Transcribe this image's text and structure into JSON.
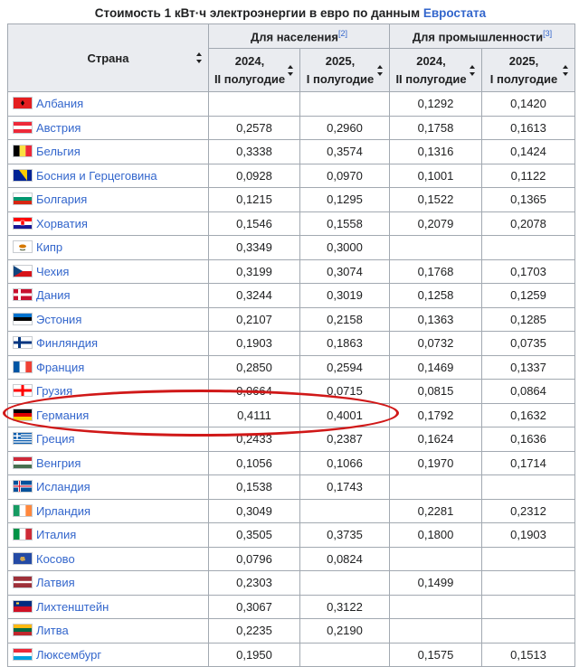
{
  "caption": {
    "text": "Стоимость 1 кВт·ч электроэнергии в евро по данным ",
    "source_link": "Евростата"
  },
  "header": {
    "country": "Страна",
    "households": "Для населения",
    "households_ref": "[2]",
    "industry": "Для промышленности",
    "industry_ref": "[3]",
    "period_2024": "2024,",
    "period_2024_half": "II полугодие",
    "period_2025": "2025,",
    "period_2025_half": "I полугодие"
  },
  "rows": [
    {
      "country": "Албания",
      "flag": "AL",
      "h2024": "",
      "h2025": "",
      "i2024": "0,1292",
      "i2025": "0,1420"
    },
    {
      "country": "Австрия",
      "flag": "AT",
      "h2024": "0,2578",
      "h2025": "0,2960",
      "i2024": "0,1758",
      "i2025": "0,1613"
    },
    {
      "country": "Бельгия",
      "flag": "BE",
      "h2024": "0,3338",
      "h2025": "0,3574",
      "i2024": "0,1316",
      "i2025": "0,1424"
    },
    {
      "country": "Босния и Герцеговина",
      "flag": "BA",
      "h2024": "0,0928",
      "h2025": "0,0970",
      "i2024": "0,1001",
      "i2025": "0,1122"
    },
    {
      "country": "Болгария",
      "flag": "BG",
      "h2024": "0,1215",
      "h2025": "0,1295",
      "i2024": "0,1522",
      "i2025": "0,1365"
    },
    {
      "country": "Хорватия",
      "flag": "HR",
      "h2024": "0,1546",
      "h2025": "0,1558",
      "i2024": "0,2079",
      "i2025": "0,2078"
    },
    {
      "country": "Кипр",
      "flag": "CY",
      "h2024": "0,3349",
      "h2025": "0,3000",
      "i2024": "",
      "i2025": ""
    },
    {
      "country": "Чехия",
      "flag": "CZ",
      "h2024": "0,3199",
      "h2025": "0,3074",
      "i2024": "0,1768",
      "i2025": "0,1703"
    },
    {
      "country": "Дания",
      "flag": "DK",
      "h2024": "0,3244",
      "h2025": "0,3019",
      "i2024": "0,1258",
      "i2025": "0,1259"
    },
    {
      "country": "Эстония",
      "flag": "EE",
      "h2024": "0,2107",
      "h2025": "0,2158",
      "i2024": "0,1363",
      "i2025": "0,1285"
    },
    {
      "country": "Финляндия",
      "flag": "FI",
      "h2024": "0,1903",
      "h2025": "0,1863",
      "i2024": "0,0732",
      "i2025": "0,0735"
    },
    {
      "country": "Франция",
      "flag": "FR",
      "h2024": "0,2850",
      "h2025": "0,2594",
      "i2024": "0,1469",
      "i2025": "0,1337"
    },
    {
      "country": "Грузия",
      "flag": "GE",
      "h2024": "0,0664",
      "h2025": "0,0715",
      "i2024": "0,0815",
      "i2025": "0,0864"
    },
    {
      "country": "Германия",
      "flag": "DE",
      "h2024": "0,4111",
      "h2025": "0,4001",
      "i2024": "0,1792",
      "i2025": "0,1632"
    },
    {
      "country": "Греция",
      "flag": "GR",
      "h2024": "0,2433",
      "h2025": "0,2387",
      "i2024": "0,1624",
      "i2025": "0,1636"
    },
    {
      "country": "Венгрия",
      "flag": "HU",
      "h2024": "0,1056",
      "h2025": "0,1066",
      "i2024": "0,1970",
      "i2025": "0,1714"
    },
    {
      "country": "Исландия",
      "flag": "IS",
      "h2024": "0,1538",
      "h2025": "0,1743",
      "i2024": "",
      "i2025": ""
    },
    {
      "country": "Ирландия",
      "flag": "IE",
      "h2024": "0,3049",
      "h2025": "",
      "i2024": "0,2281",
      "i2025": "0,2312"
    },
    {
      "country": "Италия",
      "flag": "IT",
      "h2024": "0,3505",
      "h2025": "0,3735",
      "i2024": "0,1800",
      "i2025": "0,1903"
    },
    {
      "country": "Косово",
      "flag": "XK",
      "h2024": "0,0796",
      "h2025": "0,0824",
      "i2024": "",
      "i2025": ""
    },
    {
      "country": "Латвия",
      "flag": "LV",
      "h2024": "0,2303",
      "h2025": "",
      "i2024": "0,1499",
      "i2025": ""
    },
    {
      "country": "Лихтенштейн",
      "flag": "LI",
      "h2024": "0,3067",
      "h2025": "0,3122",
      "i2024": "",
      "i2025": ""
    },
    {
      "country": "Литва",
      "flag": "LT",
      "h2024": "0,2235",
      "h2025": "0,2190",
      "i2024": "",
      "i2025": ""
    },
    {
      "country": "Люксембург",
      "flag": "LU",
      "h2024": "0,1950",
      "h2025": "",
      "i2024": "0,1575",
      "i2025": "0,1513"
    }
  ],
  "highlight": {
    "country": "Германия",
    "color": "#d01818"
  },
  "colors": {
    "link": "#3366cc",
    "header_bg": "#eaecf0",
    "border": "#a2a9b1"
  }
}
